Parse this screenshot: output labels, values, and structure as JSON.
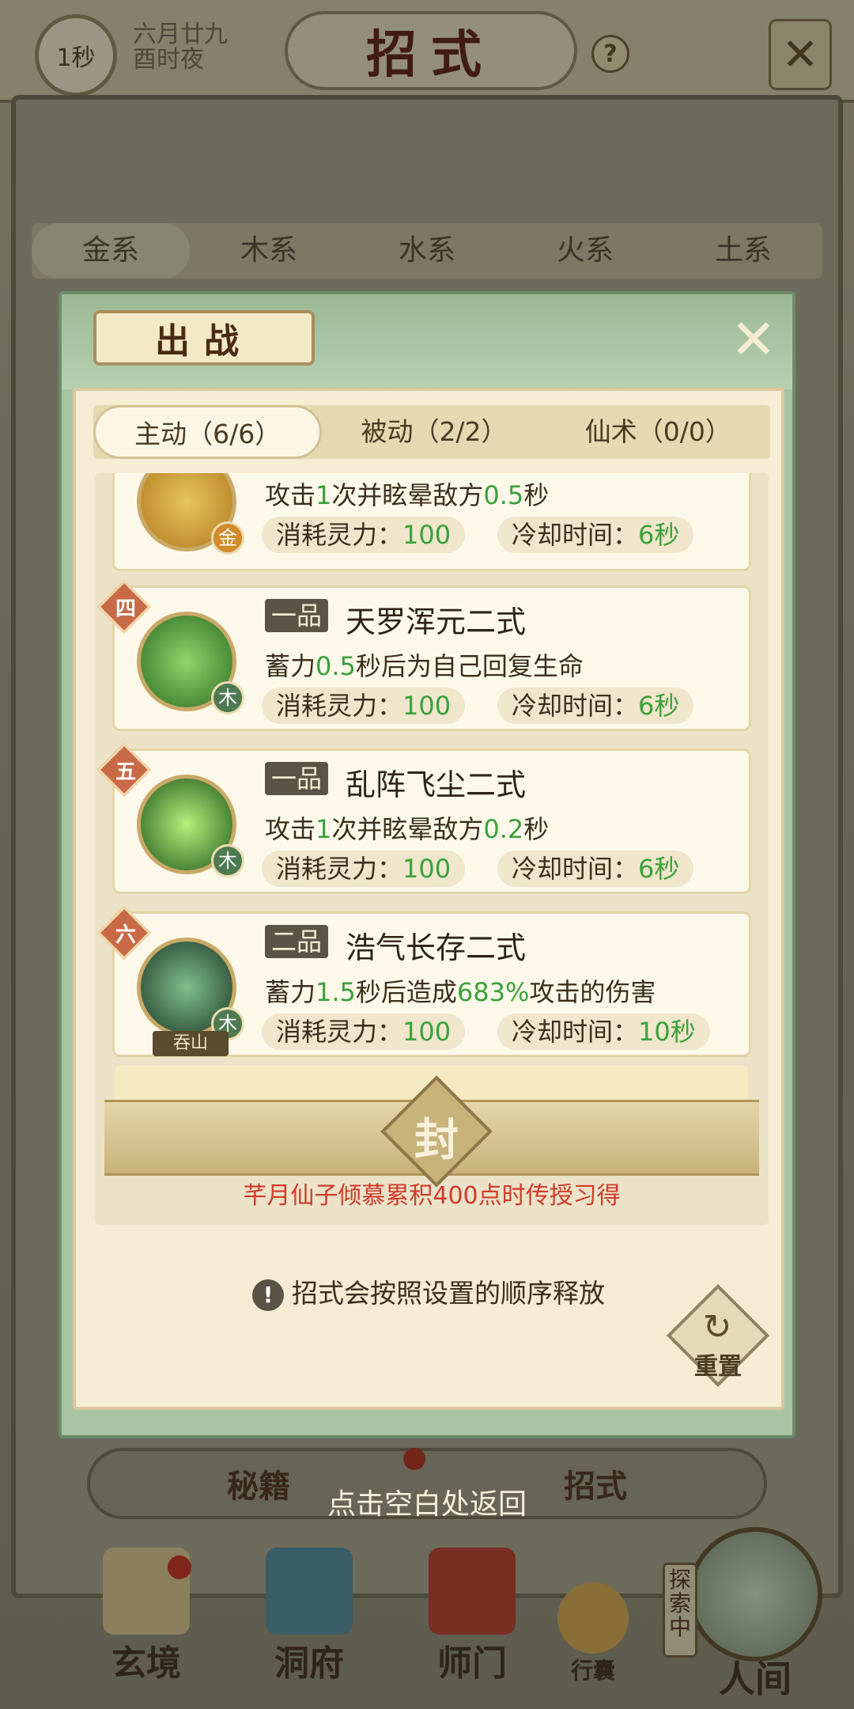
{
  "header": {
    "timer": "1秒",
    "date_line1": "六月廿九",
    "date_line2": "酉时夜",
    "title": "招式",
    "help_symbol": "?"
  },
  "element_tabs": [
    "金系",
    "木系",
    "水系",
    "火系",
    "土系"
  ],
  "modal": {
    "title": "出战",
    "sub_tabs": [
      "主动（6/6）",
      "被动（2/2）",
      "仙术（0/0）"
    ],
    "skills": [
      {
        "order": "",
        "grade": "",
        "name": "",
        "element": "金",
        "desc": [
          "攻击",
          "1",
          "次并眩晕敌方",
          "0.5",
          "秒"
        ],
        "cost_label": "消耗灵力：",
        "cost": "100",
        "cd_label": "冷却时间：",
        "cd": "6秒"
      },
      {
        "order": "四",
        "grade": "一品",
        "name": "天罗浑元二式",
        "element": "木",
        "desc": [
          "蓄力",
          "0.5",
          "秒后为自己回复生命",
          "",
          ""
        ],
        "cost_label": "消耗灵力：",
        "cost": "100",
        "cd_label": "冷却时间：",
        "cd": "6秒"
      },
      {
        "order": "五",
        "grade": "一品",
        "name": "乱阵飞尘二式",
        "element": "木",
        "desc": [
          "攻击",
          "1",
          "次并眩晕敌方",
          "0.2",
          "秒"
        ],
        "cost_label": "消耗灵力：",
        "cost": "100",
        "cd_label": "冷却时间：",
        "cd": "6秒"
      },
      {
        "order": "六",
        "grade": "二品",
        "name": "浩气长存二式",
        "element": "木",
        "tag": "吞山",
        "desc": [
          "蓄力",
          "1.5",
          "秒后造成",
          "683%",
          "攻击的伤害"
        ],
        "cost_label": "消耗灵力：",
        "cost": "100",
        "cd_label": "冷却时间：",
        "cd": "10秒"
      }
    ],
    "sealed": {
      "char": "封",
      "note": "芊月仙子倾慕累积400点时传授习得"
    },
    "hint": "招式会按照设置的顺序释放",
    "hint_icon": "!",
    "reset_label": "重置"
  },
  "bottom_tabs": [
    "秘籍",
    "招式"
  ],
  "return_hint": "点击空白处返回",
  "nav": {
    "items": [
      "玄境",
      "洞府",
      "师门",
      "行囊",
      "人间"
    ],
    "explore_tag": "探索中"
  },
  "colors": {
    "accent_green": "#3aa13a",
    "seal_note_red": "#d23a2a",
    "modal_green": "#a9c4a2",
    "title_red": "#5a1b10"
  }
}
